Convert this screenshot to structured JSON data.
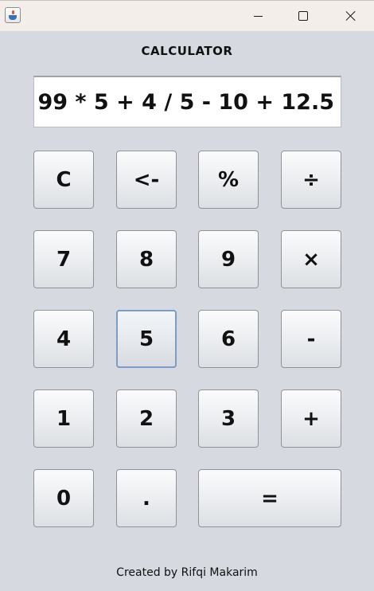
{
  "window": {
    "icon": "java-icon",
    "controls": {
      "minimize": "minimize-icon",
      "maximize": "maximize-icon",
      "close": "close-icon"
    }
  },
  "heading": "CALCULATOR",
  "display": {
    "expression": "99 * 5 + 4 / 5 - 10 + 12.5"
  },
  "keys": {
    "clear": "C",
    "backspace": "<-",
    "percent": "%",
    "divide": "÷",
    "seven": "7",
    "eight": "8",
    "nine": "9",
    "multiply": "×",
    "four": "4",
    "five": "5",
    "six": "6",
    "subtract": "-",
    "one": "1",
    "two": "2",
    "three": "3",
    "add": "+",
    "zero": "0",
    "decimal": ".",
    "equals": "="
  },
  "footer": "Created by Rifqi Makarim",
  "colors": {
    "background": "#d6d9e0",
    "titlebar": "#f3eeea",
    "display_bg": "#ffffff",
    "focus_border": "#7b9cc4"
  }
}
